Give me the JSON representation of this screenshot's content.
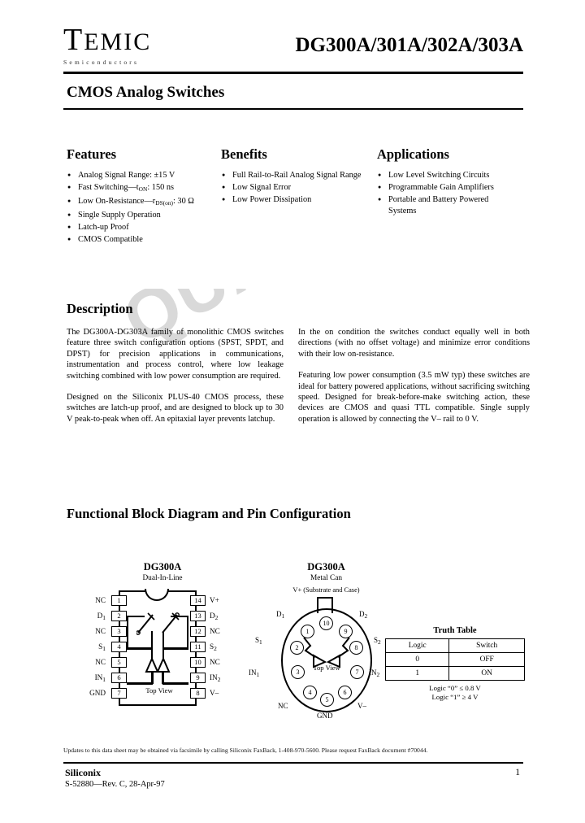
{
  "header": {
    "logo_main": "TEMIC",
    "logo_sub": "Semiconductors",
    "part_numbers": "DG300A/301A/302A/303A",
    "doc_title": "CMOS Analog Switches"
  },
  "watermark": {
    "text": "QUALIFIED"
  },
  "features": {
    "heading": "Features",
    "items": [
      "Analog Signal Range:  ±15 V",
      "Fast Switching—t",
      "Low On-Resistance—r",
      "Single Supply Operation",
      "Latch-up Proof",
      "CMOS Compatible"
    ],
    "item2_sub": "ON",
    "item2_rest": ":  150 ns",
    "item3_sub": "DS(on)",
    "item3_rest": ": 30 Ω"
  },
  "benefits": {
    "heading": "Benefits",
    "items": [
      "Full Rail-to-Rail Analog Signal Range",
      "Low Signal Error",
      "Low Power Dissipation"
    ]
  },
  "applications": {
    "heading": "Applications",
    "items": [
      "Low Level Switching Circuits",
      "Programmable Gain Amplifiers",
      "Portable and Battery Powered Systems"
    ]
  },
  "description": {
    "heading": "Description",
    "left_paragraphs": [
      "The DG300A-DG303A family of monolithic CMOS switches feature three switch configuration options (SPST, SPDT, and DPST) for precision applications in communications, instrumentation and process control, where low leakage switching combined with low power consumption are required.",
      "Designed on the Siliconix PLUS-40 CMOS process, these switches are latch-up proof, and are designed to block up to 30 V peak-to-peak when off.  An epitaxial layer prevents latchup."
    ],
    "right_paragraphs": [
      "In the on condition the switches conduct equally well in both directions (with no offset voltage) and minimize error conditions with their low on-resistance.",
      "Featuring low power consumption (3.5 mW typ) these switches are ideal for battery powered applications, without sacrificing switching speed.  Designed for break-before-make switching action, these devices are CMOS and quasi TTL compatible. Single supply operation is allowed by connecting the V– rail to 0 V."
    ]
  },
  "block_diagram": {
    "heading": "Functional Block Diagram and Pin Configuration",
    "dip": {
      "title": "DG300A",
      "subtitle": "Dual-In-Line",
      "top_view": "Top View",
      "left_pins": [
        {
          "num": "1",
          "label": "NC"
        },
        {
          "num": "2",
          "label": "D",
          "sub": "1"
        },
        {
          "num": "3",
          "label": "NC"
        },
        {
          "num": "4",
          "label": "S",
          "sub": "1"
        },
        {
          "num": "5",
          "label": "NC"
        },
        {
          "num": "6",
          "label": "IN",
          "sub": "1"
        },
        {
          "num": "7",
          "label": "GND"
        }
      ],
      "right_pins": [
        {
          "num": "14",
          "label": "V+"
        },
        {
          "num": "13",
          "label": "D",
          "sub": "2"
        },
        {
          "num": "12",
          "label": "NC"
        },
        {
          "num": "11",
          "label": "S",
          "sub": "2"
        },
        {
          "num": "10",
          "label": "NC"
        },
        {
          "num": "9",
          "label": "IN",
          "sub": "2"
        },
        {
          "num": "8",
          "label": "V–"
        }
      ]
    },
    "can": {
      "title": "DG300A",
      "subtitle": "Metal Can",
      "vplus_note": "V+ (Substrate and Case)",
      "top_view": "Top View",
      "pins": [
        {
          "num": "1",
          "label": "D",
          "sub": "1"
        },
        {
          "num": "2",
          "label": "S",
          "sub": "1"
        },
        {
          "num": "3",
          "label": "IN",
          "sub": "1"
        },
        {
          "num": "4",
          "label": "NC"
        },
        {
          "num": "5",
          "label": "GND"
        },
        {
          "num": "6",
          "label": "V–"
        },
        {
          "num": "7",
          "label": "IN",
          "sub": "2"
        },
        {
          "num": "8",
          "label": "S",
          "sub": "2"
        },
        {
          "num": "9",
          "label": "D",
          "sub": "2"
        },
        {
          "num": "10",
          "label": ""
        }
      ]
    },
    "truth_table": {
      "title": "Truth Table",
      "columns": [
        "Logic",
        "Switch"
      ],
      "rows": [
        [
          "0",
          "OFF"
        ],
        [
          "1",
          "ON"
        ]
      ],
      "notes": [
        "Logic “0” ≤ 0.8 V",
        "Logic “1” ≥ 4 V"
      ]
    }
  },
  "footer": {
    "fax_note": "Updates to this data sheet may be obtained via facsimile by calling Siliconix FaxBack, 1-408-970-5600.  Please request FaxBack document #70044.",
    "brand": "Siliconix",
    "revision": "S-52880—Rev. C, 28-Apr-97",
    "page": "1"
  }
}
